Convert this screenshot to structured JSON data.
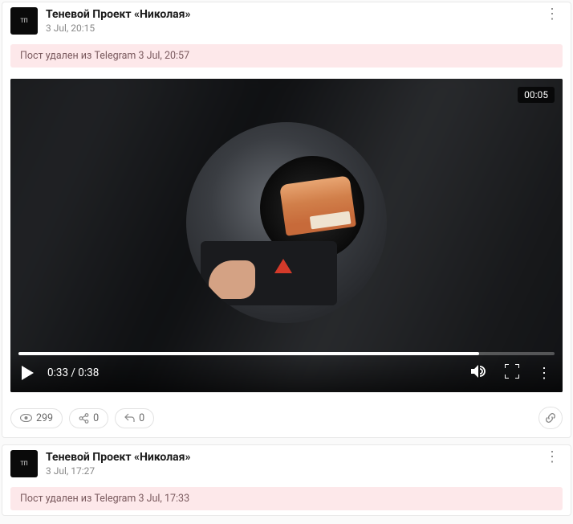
{
  "posts": [
    {
      "channel": "Теневой Проект «Николая»",
      "time": "3 Jul, 20:15",
      "deleted_text": "Пост удален из Telegram 3 Jul, 20:57",
      "video": {
        "duration_badge": "00:05",
        "time_display": "0:33 / 0:38"
      },
      "stats": {
        "views": "299",
        "shares": "0",
        "replies": "0"
      }
    },
    {
      "channel": "Теневой Проект «Николая»",
      "time": "3 Jul, 17:27",
      "deleted_text": "Пост удален из Telegram 3 Jul, 17:33"
    }
  ]
}
